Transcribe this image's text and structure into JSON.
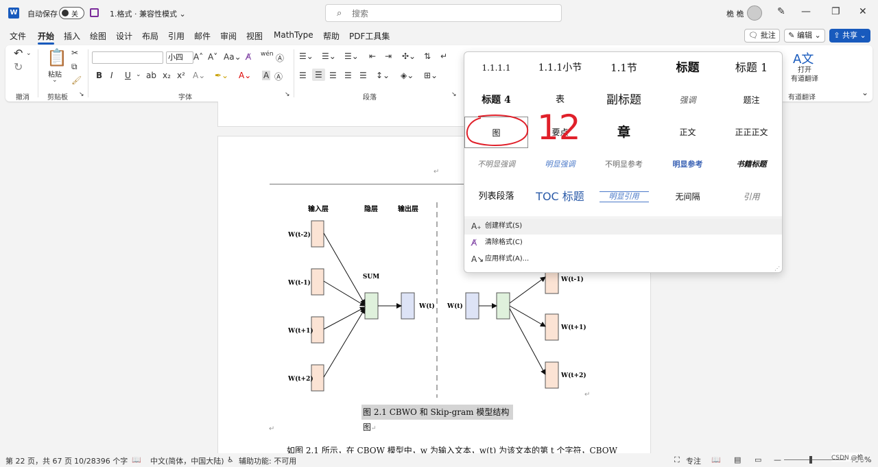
{
  "titlebar": {
    "app_icon": "W",
    "autosave_label": "自动保存",
    "autosave_state": "关",
    "doc_title": "1.格式 · 兼容性模式 ⌄",
    "search_placeholder": "搜索",
    "user_name": "桅 桅"
  },
  "menu": {
    "tabs": [
      "文件",
      "开始",
      "插入",
      "绘图",
      "设计",
      "布局",
      "引用",
      "邮件",
      "审阅",
      "视图",
      "MathType",
      "帮助",
      "PDF工具集"
    ],
    "active": "开始",
    "comment_label": "批注",
    "edit_label": "编辑 ⌄",
    "share_label": "共享 ⌄"
  },
  "ribbon": {
    "paste_label": "粘贴",
    "font_size": "小四",
    "groups": {
      "undo": "撤消",
      "clipboard": "剪贴板",
      "font": "字体",
      "paragraph": "段落",
      "translate": "有道翻译"
    },
    "translate_button": "打开\n有道翻译",
    "format_buttons": [
      "B",
      "I",
      "U",
      "x₂",
      "x²"
    ]
  },
  "gallery": {
    "styles": [
      [
        "1.1.1.1",
        "1.1.1小节",
        "1.1节",
        "标题",
        "标题 1"
      ],
      [
        "标题 4",
        "表",
        "副标题",
        "强调",
        "题注"
      ],
      [
        "图",
        "要点",
        "章",
        "正文",
        "正正正文"
      ],
      [
        "不明显强调",
        "明显强调",
        "不明显参考",
        "明显参考",
        "书籍标题"
      ],
      [
        "列表段落",
        "TOC 标题",
        "明显引用",
        "无间隔",
        "引用"
      ]
    ],
    "selected_style": "图",
    "annotation_number": "12",
    "commands": [
      "创建样式(S)",
      "清除格式(C)",
      "应用样式(A)..."
    ]
  },
  "document": {
    "diagram": {
      "left_headers": [
        "输入层",
        "隐层",
        "输出层"
      ],
      "left_inputs": [
        "W(t-2)",
        "W(t-1)",
        "W(t+1)",
        "W(t+2)"
      ],
      "sum_label": "SUM",
      "left_output": "W(t)",
      "right_input": "W(t)",
      "right_outputs": [
        "W(t-1)",
        "W(t+1)",
        "W(t+2)"
      ]
    },
    "caption": "图 2.1 CBWO 和 Skip-gram 模型结构图",
    "body_text": "如图 2.1 所示，在 CBOW 模型中，w 为输入文本，w(t) 为该文本的第 t 个字符，CBOW",
    "pilcrow": "↵"
  },
  "statusbar": {
    "page": "第 22 页，共 67 页",
    "words": "10/28396 个字",
    "language": "中文(简体，中国大陆)",
    "accessibility": "辅助功能: 不可用",
    "focus": "专注",
    "zoom": "96%",
    "watermark": "CSDN @桅"
  },
  "colors": {
    "accent": "#185abd",
    "box_peach": "#fbe3d4",
    "box_green": "#dff1dc",
    "box_lavender": "#dde3f6",
    "annotation_red": "#e0202a"
  }
}
